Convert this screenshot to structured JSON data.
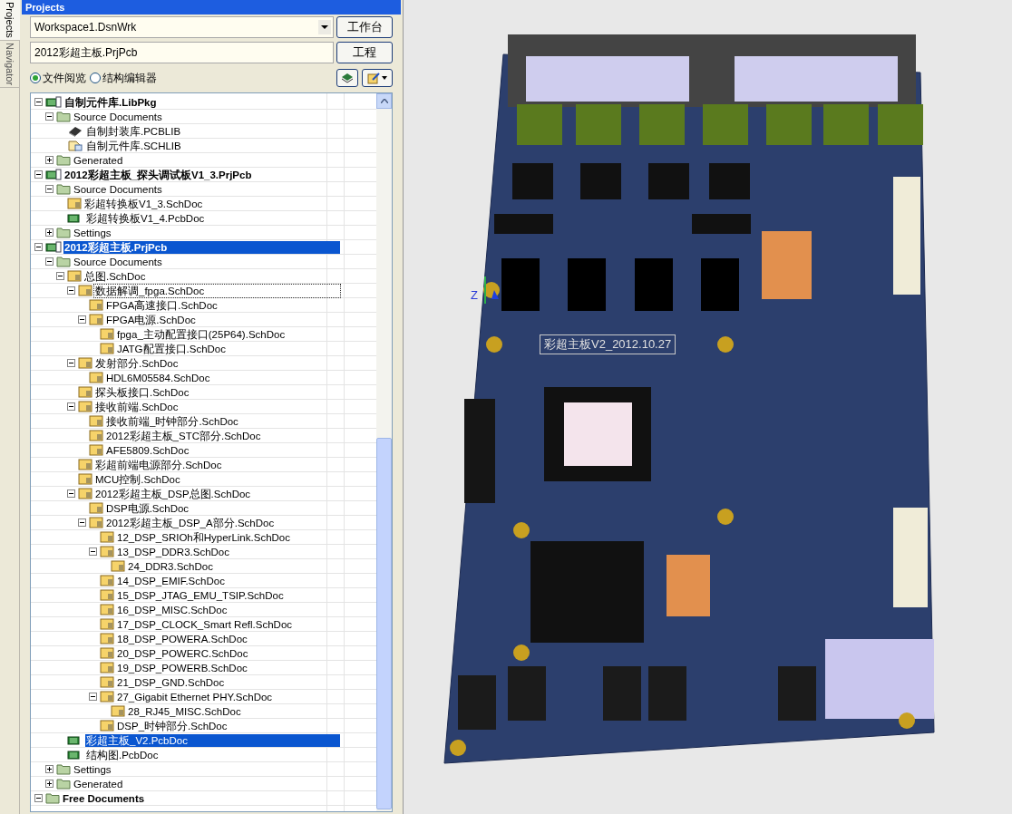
{
  "side_tabs": [
    {
      "label": "Projects",
      "selected": true
    },
    {
      "label": "Navigator",
      "selected": false
    }
  ],
  "panel": {
    "title": "Projects",
    "workspace": "Workspace1.DsnWrk",
    "workspace_button": "工作台",
    "project": "2012彩超主板.PrjPcb",
    "project_button": "工程",
    "views": [
      {
        "label": "文件阅览",
        "selected": true
      },
      {
        "label": "结构编辑器",
        "selected": false
      }
    ]
  },
  "tree": [
    {
      "label": "自制元件库.LibPkg",
      "kind": "libpkg",
      "bold": true,
      "expanded": true,
      "selected": false,
      "children": [
        {
          "label": "Source Documents",
          "kind": "folder",
          "expanded": true,
          "selected": false,
          "children": [
            {
              "label": "自制封装库.PCBLIB",
              "kind": "pcblib",
              "selected": false
            },
            {
              "label": "自制元件库.SCHLIB",
              "kind": "schlib",
              "selected": false
            }
          ]
        },
        {
          "label": "Generated",
          "kind": "folder",
          "expanded": false,
          "selected": false
        }
      ]
    },
    {
      "label": "2012彩超主板_探头调试板V1_3.PrjPcb",
      "kind": "project",
      "bold": true,
      "expanded": true,
      "selected": false,
      "children": [
        {
          "label": "Source Documents",
          "kind": "folder",
          "expanded": true,
          "selected": false,
          "children": [
            {
              "label": "彩超转换板V1_3.SchDoc",
              "kind": "sch",
              "selected": false
            },
            {
              "label": "彩超转换板V1_4.PcbDoc",
              "kind": "pcb",
              "selected": false
            }
          ]
        },
        {
          "label": "Settings",
          "kind": "folder",
          "expanded": false,
          "selected": false
        }
      ]
    },
    {
      "label": "2012彩超主板.PrjPcb",
      "kind": "project",
      "bold": true,
      "expanded": true,
      "selected": true,
      "children": [
        {
          "label": "Source Documents",
          "kind": "folder",
          "expanded": true,
          "selected": false,
          "children": [
            {
              "label": "总图.SchDoc",
              "kind": "sch",
              "expanded": true,
              "selected": false,
              "children": [
                {
                  "label": "数据解调_fpga.SchDoc",
                  "kind": "sch",
                  "expanded": true,
                  "selected": false,
                  "focused": true,
                  "children": [
                    {
                      "label": "FPGA高速接口.SchDoc",
                      "kind": "sch",
                      "selected": false
                    },
                    {
                      "label": "FPGA电源.SchDoc",
                      "kind": "sch",
                      "expanded": true,
                      "selected": false,
                      "children": [
                        {
                          "label": "fpga_主动配置接口(25P64).SchDoc",
                          "kind": "sch",
                          "selected": false
                        },
                        {
                          "label": "JATG配置接口.SchDoc",
                          "kind": "sch",
                          "selected": false
                        }
                      ]
                    }
                  ]
                },
                {
                  "label": "发射部分.SchDoc",
                  "kind": "sch",
                  "expanded": true,
                  "selected": false,
                  "children": [
                    {
                      "label": "HDL6M05584.SchDoc",
                      "kind": "sch",
                      "selected": false
                    }
                  ]
                },
                {
                  "label": "探头板接口.SchDoc",
                  "kind": "sch",
                  "selected": false
                },
                {
                  "label": "接收前端.SchDoc",
                  "kind": "sch",
                  "expanded": true,
                  "selected": false,
                  "children": [
                    {
                      "label": "接收前端_时钟部分.SchDoc",
                      "kind": "sch",
                      "selected": false
                    },
                    {
                      "label": "2012彩超主板_STC部分.SchDoc",
                      "kind": "sch",
                      "selected": false
                    },
                    {
                      "label": "AFE5809.SchDoc",
                      "kind": "sch",
                      "selected": false
                    }
                  ]
                },
                {
                  "label": "彩超前端电源部分.SchDoc",
                  "kind": "sch",
                  "selected": false
                },
                {
                  "label": "MCU控制.SchDoc",
                  "kind": "sch",
                  "selected": false
                },
                {
                  "label": "2012彩超主板_DSP总图.SchDoc",
                  "kind": "sch",
                  "expanded": true,
                  "selected": false,
                  "children": [
                    {
                      "label": "DSP电源.SchDoc",
                      "kind": "sch",
                      "selected": false
                    },
                    {
                      "label": "2012彩超主板_DSP_A部分.SchDoc",
                      "kind": "sch",
                      "expanded": true,
                      "selected": false,
                      "children": [
                        {
                          "label": "12_DSP_SRIOh和HyperLink.SchDoc",
                          "kind": "sch",
                          "selected": false
                        },
                        {
                          "label": "13_DSP_DDR3.SchDoc",
                          "kind": "sch",
                          "expanded": true,
                          "selected": false,
                          "children": [
                            {
                              "label": "24_DDR3.SchDoc",
                              "kind": "sch",
                              "selected": false
                            }
                          ]
                        },
                        {
                          "label": "14_DSP_EMIF.SchDoc",
                          "kind": "sch",
                          "selected": false
                        },
                        {
                          "label": "15_DSP_JTAG_EMU_TSIP.SchDoc",
                          "kind": "sch",
                          "selected": false
                        },
                        {
                          "label": "16_DSP_MISC.SchDoc",
                          "kind": "sch",
                          "selected": false
                        },
                        {
                          "label": "17_DSP_CLOCK_Smart Refl.SchDoc",
                          "kind": "sch",
                          "selected": false
                        },
                        {
                          "label": "18_DSP_POWERA.SchDoc",
                          "kind": "sch",
                          "selected": false
                        },
                        {
                          "label": "20_DSP_POWERC.SchDoc",
                          "kind": "sch",
                          "selected": false
                        },
                        {
                          "label": "19_DSP_POWERB.SchDoc",
                          "kind": "sch",
                          "selected": false
                        },
                        {
                          "label": "21_DSP_GND.SchDoc",
                          "kind": "sch",
                          "selected": false
                        },
                        {
                          "label": "27_Gigabit Ethernet PHY.SchDoc",
                          "kind": "sch",
                          "expanded": true,
                          "selected": false,
                          "children": [
                            {
                              "label": "28_RJ45_MISC.SchDoc",
                              "kind": "sch",
                              "selected": false
                            }
                          ]
                        },
                        {
                          "label": "DSP_时钟部分.SchDoc",
                          "kind": "sch",
                          "selected": false
                        }
                      ]
                    }
                  ]
                }
              ]
            },
            {
              "label": "彩超主板_V2.PcbDoc",
              "kind": "pcb",
              "selected": true
            },
            {
              "label": "结构图.PcbDoc",
              "kind": "pcb",
              "selected": false
            }
          ]
        },
        {
          "label": "Settings",
          "kind": "folder",
          "expanded": false,
          "selected": false
        },
        {
          "label": "Generated",
          "kind": "folder",
          "expanded": false,
          "selected": false
        }
      ]
    },
    {
      "label": "Free Documents",
      "kind": "folder",
      "bold": true,
      "expanded": true,
      "selected": false
    }
  ],
  "viewport": {
    "axis_label": "Z",
    "board_label": "彩超主板V2_2012.10.27"
  }
}
